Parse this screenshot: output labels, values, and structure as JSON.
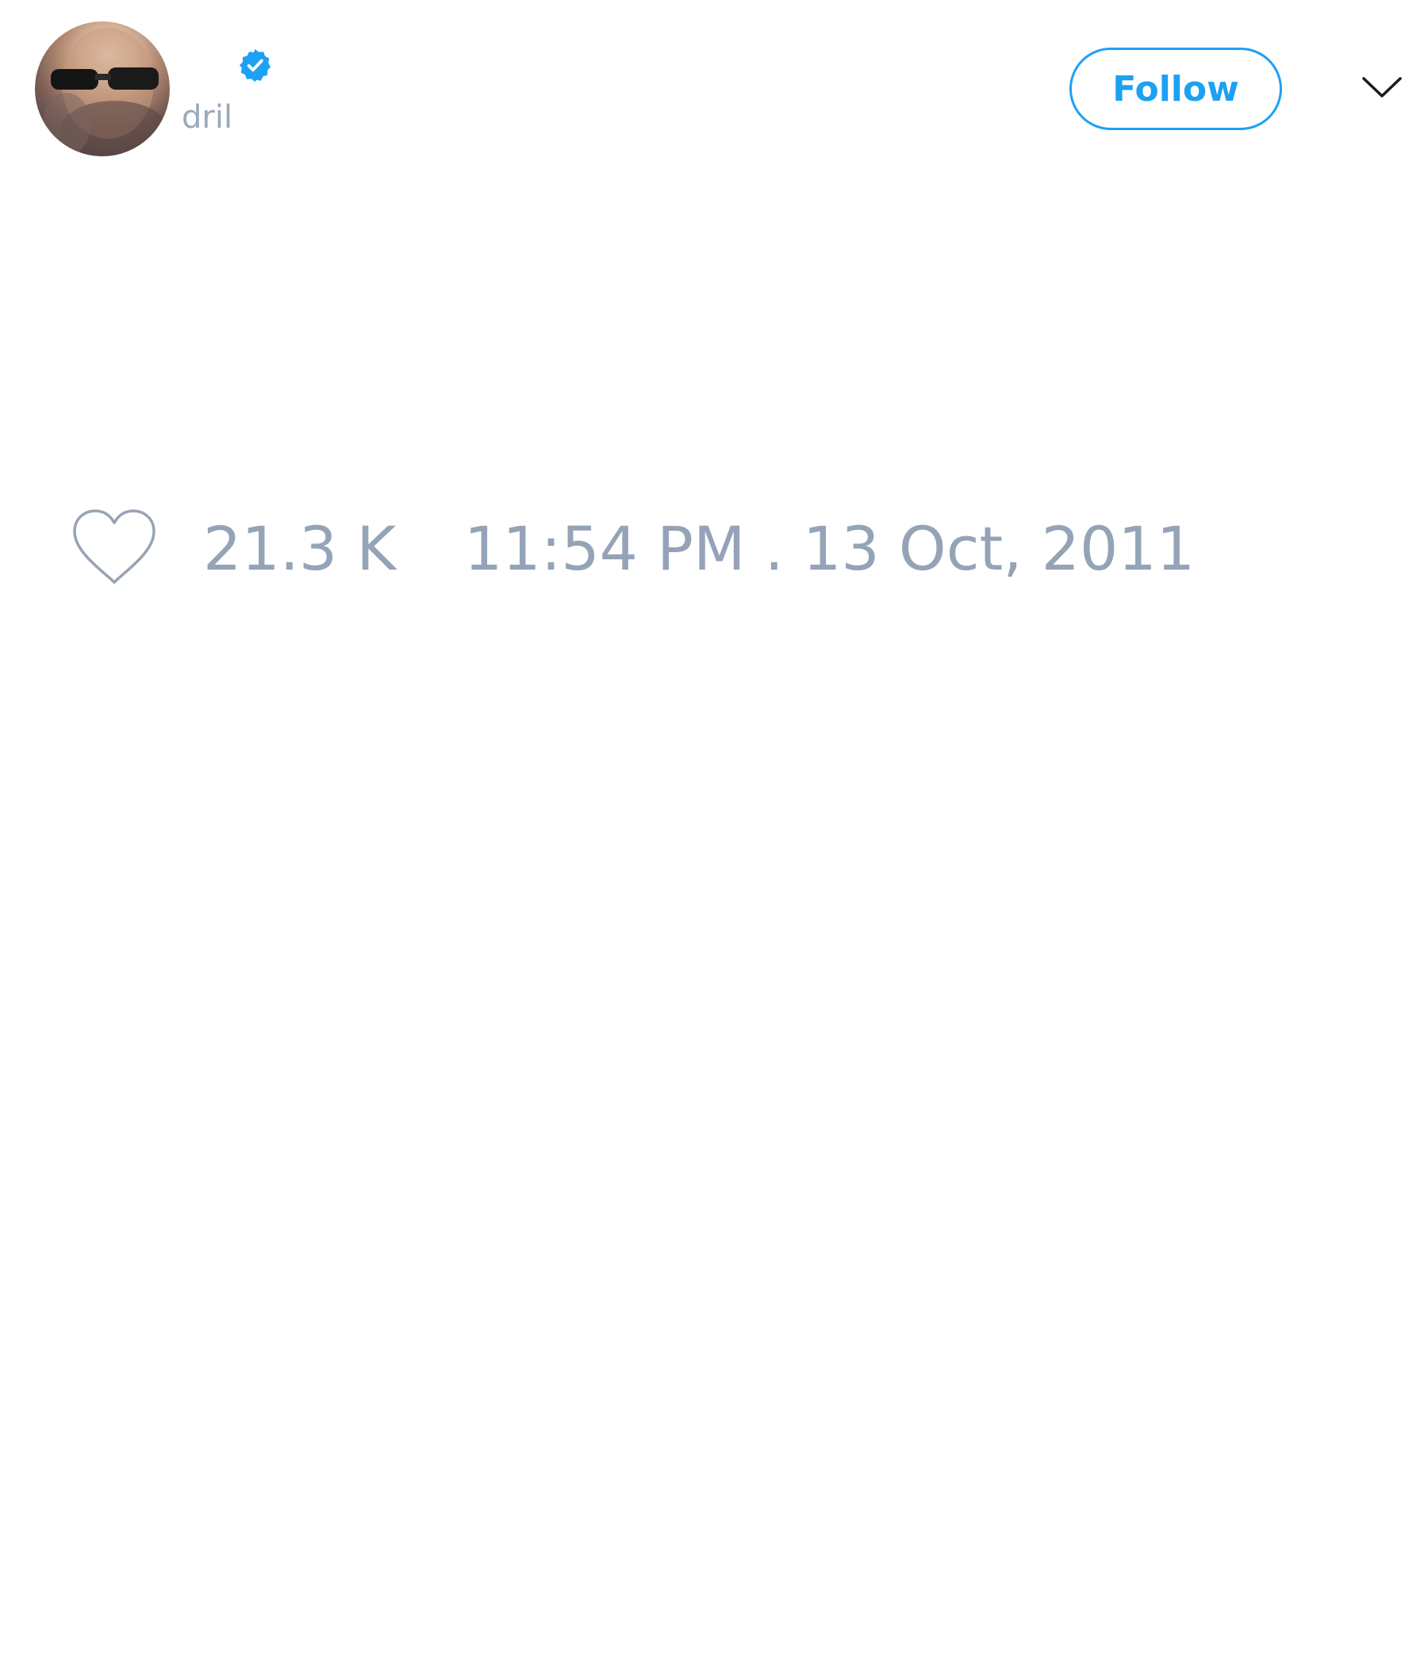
{
  "tweet": {
    "author": {
      "display_name": "",
      "handle": "dril",
      "verified": true,
      "avatar_icon": "profile-photo"
    },
    "follow_label": "Follow",
    "menu_icon": "chevron-down-icon",
    "likes": {
      "icon": "heart-outline-icon",
      "count": "21.3 K"
    },
    "timestamp": "11:54 PM . 13 Oct, 2011"
  },
  "colors": {
    "accent": "#1da1f2",
    "muted_text": "#95a3b7",
    "background": "#ffffff"
  }
}
